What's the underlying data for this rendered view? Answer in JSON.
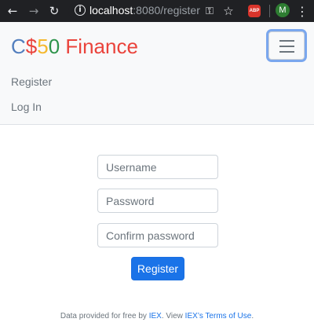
{
  "browser": {
    "url_host": "localhost",
    "url_rest": ":8080/register",
    "back_icon": "arrow-left-icon",
    "forward_icon": "arrow-right-icon",
    "reload_icon": "reload-icon",
    "info_icon": "info-icon",
    "key_icon": "key-icon",
    "star_icon": "star-icon",
    "adblock_label": "ABP",
    "profile_initial": "M",
    "menu_icon": "kebab-menu-icon"
  },
  "navbar": {
    "brand": {
      "c": "C",
      "dollar": "$",
      "five": "5",
      "zero": "0",
      "finance": "Finance"
    },
    "toggler_icon": "hamburger-icon",
    "links": [
      "Register",
      "Log In"
    ]
  },
  "form": {
    "username_placeholder": "Username",
    "password_placeholder": "Password",
    "confirm_placeholder": "Confirm password",
    "submit_label": "Register"
  },
  "footer": {
    "prefix": "Data provided for free by ",
    "iex_link": "IEX",
    "middle": ". View ",
    "terms_link": "IEX’s Terms of Use",
    "suffix": "."
  },
  "colors": {
    "brand_blue": "#537fbe",
    "brand_red": "#ea433b",
    "brand_yellow": "#f5b82e",
    "brand_green": "#2e944b",
    "primary": "#1a73e8"
  }
}
